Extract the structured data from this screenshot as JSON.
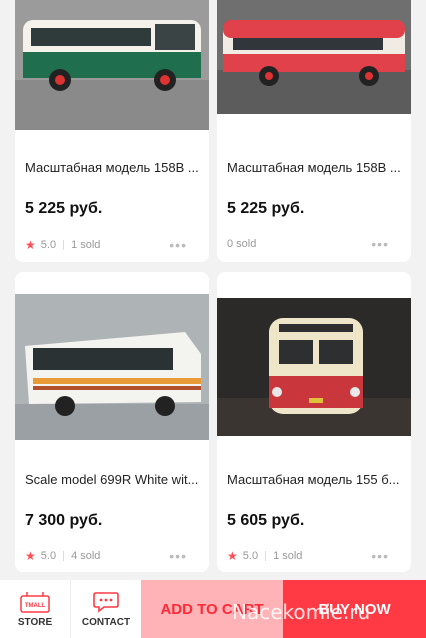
{
  "products": [
    {
      "title": "Масштабная модель 158В ...",
      "price": "5 225 руб.",
      "rating": "5.0",
      "sold": "1 sold"
    },
    {
      "title": "Масштабная модель 158В ...",
      "price": "5 225 руб.",
      "rating": "",
      "sold": "0 sold"
    },
    {
      "title": "Scale model 699R White wit...",
      "price": "7 300 руб.",
      "rating": "5.0",
      "sold": "4 sold"
    },
    {
      "title": "Масштабная модель 155 б...",
      "price": "5 605 руб.",
      "rating": "5.0",
      "sold": "1 sold"
    }
  ],
  "more_icon": "more-dots-icon",
  "bottom_bar": {
    "store_label": "STORE",
    "contact_label": "CONTACT",
    "add_to_cart_label": "ADD TO CART",
    "buy_now_label": "BUY NOW",
    "store_icon_text": "TMALL"
  },
  "watermark": "Nacekomie.ru",
  "colors": {
    "accent": "#ff3a45",
    "cart_bg": "#ffb3b7",
    "star": "#ff4e55"
  }
}
